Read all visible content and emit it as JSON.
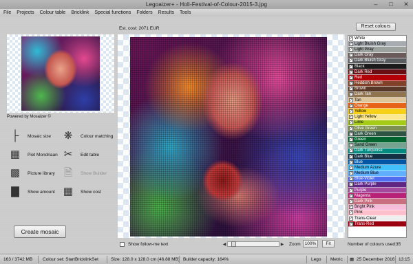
{
  "window": {
    "title": "Legoaizer+   - Holi-Festival-of-Colour-2015-3.jpg",
    "min_icon": "minimize-icon",
    "max_icon": "maximize-icon",
    "close_icon": "close-icon"
  },
  "menu": [
    "File",
    "Projects",
    "Colour table",
    "Bricklink",
    "Special functions",
    "Folders",
    "Results",
    "Tools"
  ],
  "est_cost": "Est. cost: 2071 EUR",
  "reset_colours": "Reset colours",
  "powered_by": "Powered by Mosaizer ©",
  "tools": {
    "mosaic_size": "Mosaic size",
    "colour_matching": "Colour matching",
    "piet_mondriaan": "Piet Mondriaan",
    "edit_table": "Edit table",
    "picture_library": "Picture library",
    "show_builder": "Show Builder",
    "show_amount": "Show amount",
    "show_cost": "Show cost"
  },
  "create_mosaic": "Create mosaic",
  "follow_me": "Show follow-me text",
  "zoom": {
    "label": "Zoom",
    "value": "100%",
    "fit": "Fit",
    "slider_fraction": 0.08
  },
  "colours": [
    {
      "name": "White",
      "color": "#ffffff",
      "text": "#000000",
      "checked": true
    },
    {
      "name": "Light Bluish Gray",
      "color": "#a5abb1",
      "text": "#000000",
      "checked": true
    },
    {
      "name": "Light Gray",
      "color": "#9ba19d",
      "text": "#000000",
      "checked": true
    },
    {
      "name": "Dark Gray",
      "color": "#6b5a5a",
      "text": "#ffffff",
      "checked": true
    },
    {
      "name": "Dark Bluish Gray",
      "color": "#595d60",
      "text": "#ffffff",
      "checked": true
    },
    {
      "name": "Black",
      "color": "#1b1b1b",
      "text": "#ffffff",
      "checked": true
    },
    {
      "name": "Dark Red",
      "color": "#6a0e15",
      "text": "#ffffff",
      "checked": true
    },
    {
      "name": "Red",
      "color": "#b30006",
      "text": "#ffffff",
      "checked": true
    },
    {
      "name": "Reddish Brown",
      "color": "#82422a",
      "text": "#ffffff",
      "checked": true
    },
    {
      "name": "Brown",
      "color": "#583927",
      "text": "#ffffff",
      "checked": true
    },
    {
      "name": "Dark Tan",
      "color": "#907450",
      "text": "#ffffff",
      "checked": true
    },
    {
      "name": "Tan",
      "color": "#dec69c",
      "text": "#000000",
      "checked": true
    },
    {
      "name": "Orange",
      "color": "#e76318",
      "text": "#ffffff",
      "checked": true
    },
    {
      "name": "Yellow",
      "color": "#f7d117",
      "text": "#000000",
      "checked": true
    },
    {
      "name": "Light Yellow",
      "color": "#fbe890",
      "text": "#000000",
      "checked": true
    },
    {
      "name": "Lime",
      "color": "#a5ca18",
      "text": "#000000",
      "checked": true
    },
    {
      "name": "Olive Green",
      "color": "#7c9051",
      "text": "#ffffff",
      "checked": true
    },
    {
      "name": "Dark Green",
      "color": "#2e5543",
      "text": "#ffffff",
      "checked": true
    },
    {
      "name": "Green",
      "color": "#00642e",
      "text": "#ffffff",
      "checked": true
    },
    {
      "name": "Sand Green",
      "color": "#76a290",
      "text": "#000000",
      "checked": true
    },
    {
      "name": "Dark Turquoise",
      "color": "#008a80",
      "text": "#ffffff",
      "checked": true
    },
    {
      "name": "Dark Blue",
      "color": "#143044",
      "text": "#ffffff",
      "checked": true
    },
    {
      "name": "Blue",
      "color": "#0057a6",
      "text": "#ffffff",
      "checked": true
    },
    {
      "name": "Medium Azure",
      "color": "#42c0fb",
      "text": "#000000",
      "checked": true
    },
    {
      "name": "Medium Blue",
      "color": "#61afff",
      "text": "#000000",
      "checked": true
    },
    {
      "name": "Blue-Violet",
      "color": "#506cef",
      "text": "#ffffff",
      "checked": true
    },
    {
      "name": "Dark Purple",
      "color": "#5f2683",
      "text": "#ffffff",
      "checked": true
    },
    {
      "name": "Purple",
      "color": "#a5499c",
      "text": "#ffffff",
      "checked": true
    },
    {
      "name": "Magenta",
      "color": "#b72276",
      "text": "#ffffff",
      "checked": true
    },
    {
      "name": "Dark Pink",
      "color": "#c87080",
      "text": "#ffffff",
      "checked": true
    },
    {
      "name": "Bright Pink",
      "color": "#f7bcda",
      "text": "#000000",
      "checked": true
    },
    {
      "name": "Pink",
      "color": "#ffc0cb",
      "text": "#000000",
      "checked": true
    },
    {
      "name": "Trans-Clear",
      "color": "#eeeeee",
      "text": "#000000",
      "checked": true
    },
    {
      "name": "Trans-Red",
      "color": "#9c0010",
      "text": "#ffffff",
      "checked": true
    }
  ],
  "num_colours": {
    "label": "Number of colours used:",
    "value": "35"
  },
  "status": {
    "memory": "163 / 3742 MB",
    "colour_set": "Colour set: StartBricklinkSet",
    "size": "Size: 128.0 x 128.0 cm (46.88 MB)",
    "capacity": "Builder capacity: 164%",
    "brand": "Lego",
    "units": "Metric",
    "date": "25 December 2016",
    "time": "13:15"
  }
}
